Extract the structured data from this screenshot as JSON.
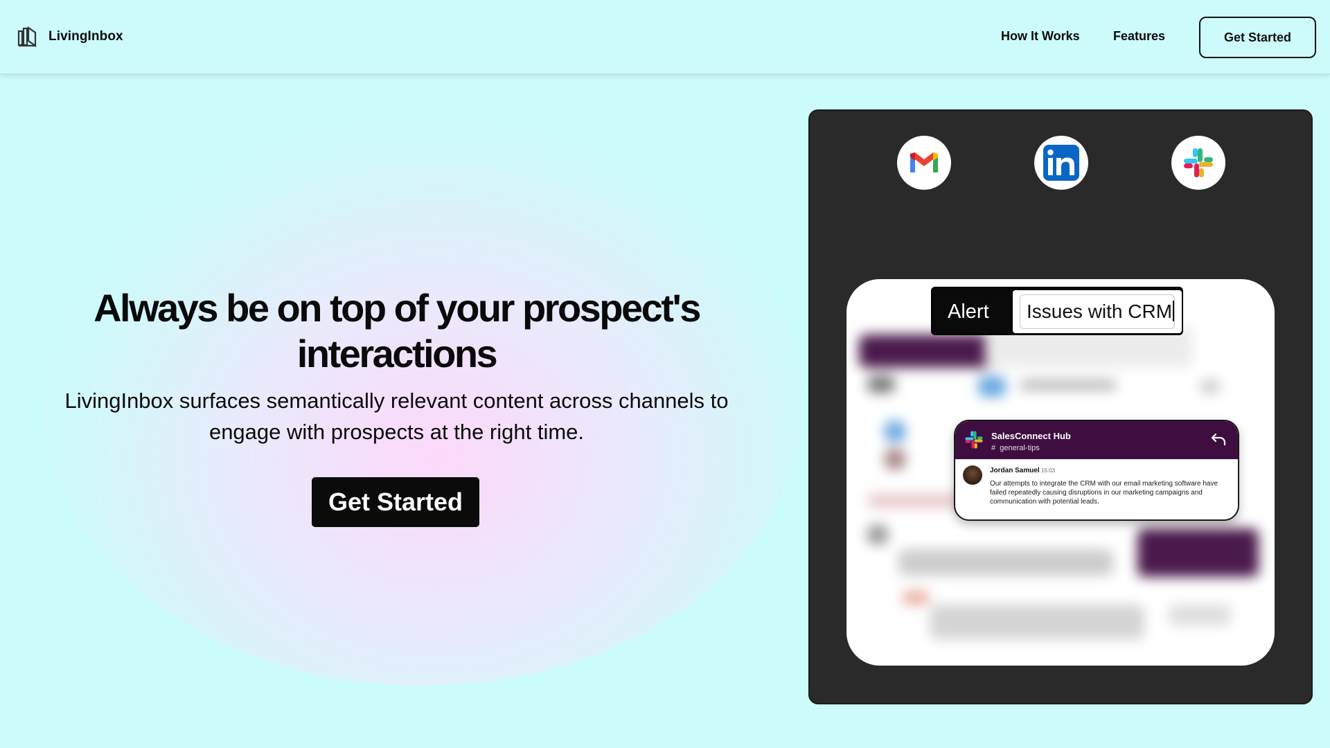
{
  "header": {
    "logo_text": "LivingInbox",
    "nav": [
      "How It Works",
      "Features"
    ],
    "cta_label": "Get Started"
  },
  "hero": {
    "title": "Always be on top of your prospect's interactions",
    "subtitle": "LivingInbox surfaces semantically relevant content across channels to engage with prospects at the right time.",
    "cta_label": "Get Started"
  },
  "panel": {
    "icons": [
      "gmail-icon",
      "linkedin-icon",
      "slack-icon"
    ],
    "alert": {
      "label": "Alert",
      "input_value": "Issues with CRM"
    },
    "slack_message": {
      "workspace": "SalesConnect Hub",
      "channel": "general-tips",
      "author": "Jordan Samuel",
      "time": "15:03",
      "text": "Our attempts to integrate the CRM with our email marketing software have failed repeatedly causing disruptions in our marketing campaigns and communication with potential leads."
    }
  },
  "colors": {
    "background": "#cbfbfb",
    "panel": "#2a2a2a",
    "slack_header": "#3f0e40",
    "button": "#0b0b0b"
  }
}
